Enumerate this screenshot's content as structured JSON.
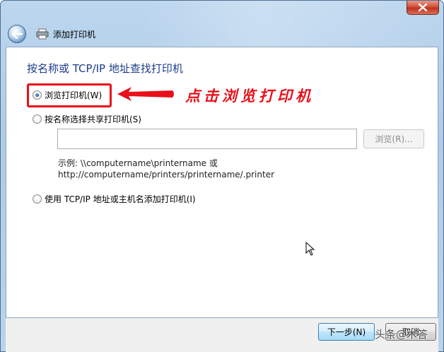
{
  "window": {
    "title": "添加打印机",
    "close_icon": "close-icon",
    "back_icon": "back-arrow-icon",
    "printer_icon": "printer-icon"
  },
  "content": {
    "heading": "按名称或 TCP/IP 地址查找打印机",
    "option_browse": "浏览打印机(W)",
    "option_share_name": "按名称选择共享打印机(S)",
    "share_name_value": "",
    "browse_button": "浏览(R)...",
    "example_line1": "示例: \\\\computername\\printername 或",
    "example_line2": "http://computername/printers/printername/.printer",
    "option_tcpip": "使用 TCP/IP 地址或主机名添加打印机(I)",
    "selected_option": "option_browse"
  },
  "annotation": {
    "text": "点击浏览打印机",
    "color": "#e8101a"
  },
  "footer": {
    "next_button": "下一步(N)",
    "cancel_button": "取消"
  },
  "watermark": "头条@木答",
  "colors": {
    "heading": "#1e3c8c",
    "accent_red": "#e8101a",
    "frame": "#b9d3ec"
  }
}
